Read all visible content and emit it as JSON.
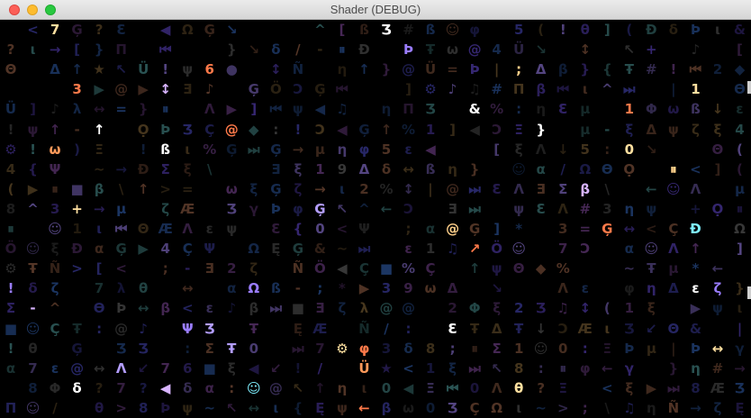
{
  "window": {
    "title": "Shader (DEBUG)"
  },
  "shader": {
    "columns": 34,
    "rows": 20,
    "glyphs": "↙↖↗↘←↑→↓↔↕◀▶⏮⏭⏸●■◆★♪♫☺⚙ΛΣΦΩΘΔΞΨΠλμφθξψωεβαγδζηι0123456789{}[]()<>/\\|=+-*%#@&!?:;~^ĘĢƟỌÖÜŦÆÇÑÐÞßƆƐƎƷɅ",
    "palette": [
      "#2a2a6e",
      "#3a2a7a",
      "#1e3a6a",
      "#4b3a20",
      "#3a3a3a",
      "#5a4a8a",
      "#2e5a5a",
      "#5a3a2a",
      "#4a2a5a"
    ],
    "bright_palette": [
      "#ffffff",
      "#b39dff",
      "#ff9a5a",
      "#ffd08a",
      "#7ff0ff",
      "#d8b4ff",
      "#ff7a4a",
      "#9a7dff",
      "#ffe0a0"
    ],
    "seed": 7919
  }
}
